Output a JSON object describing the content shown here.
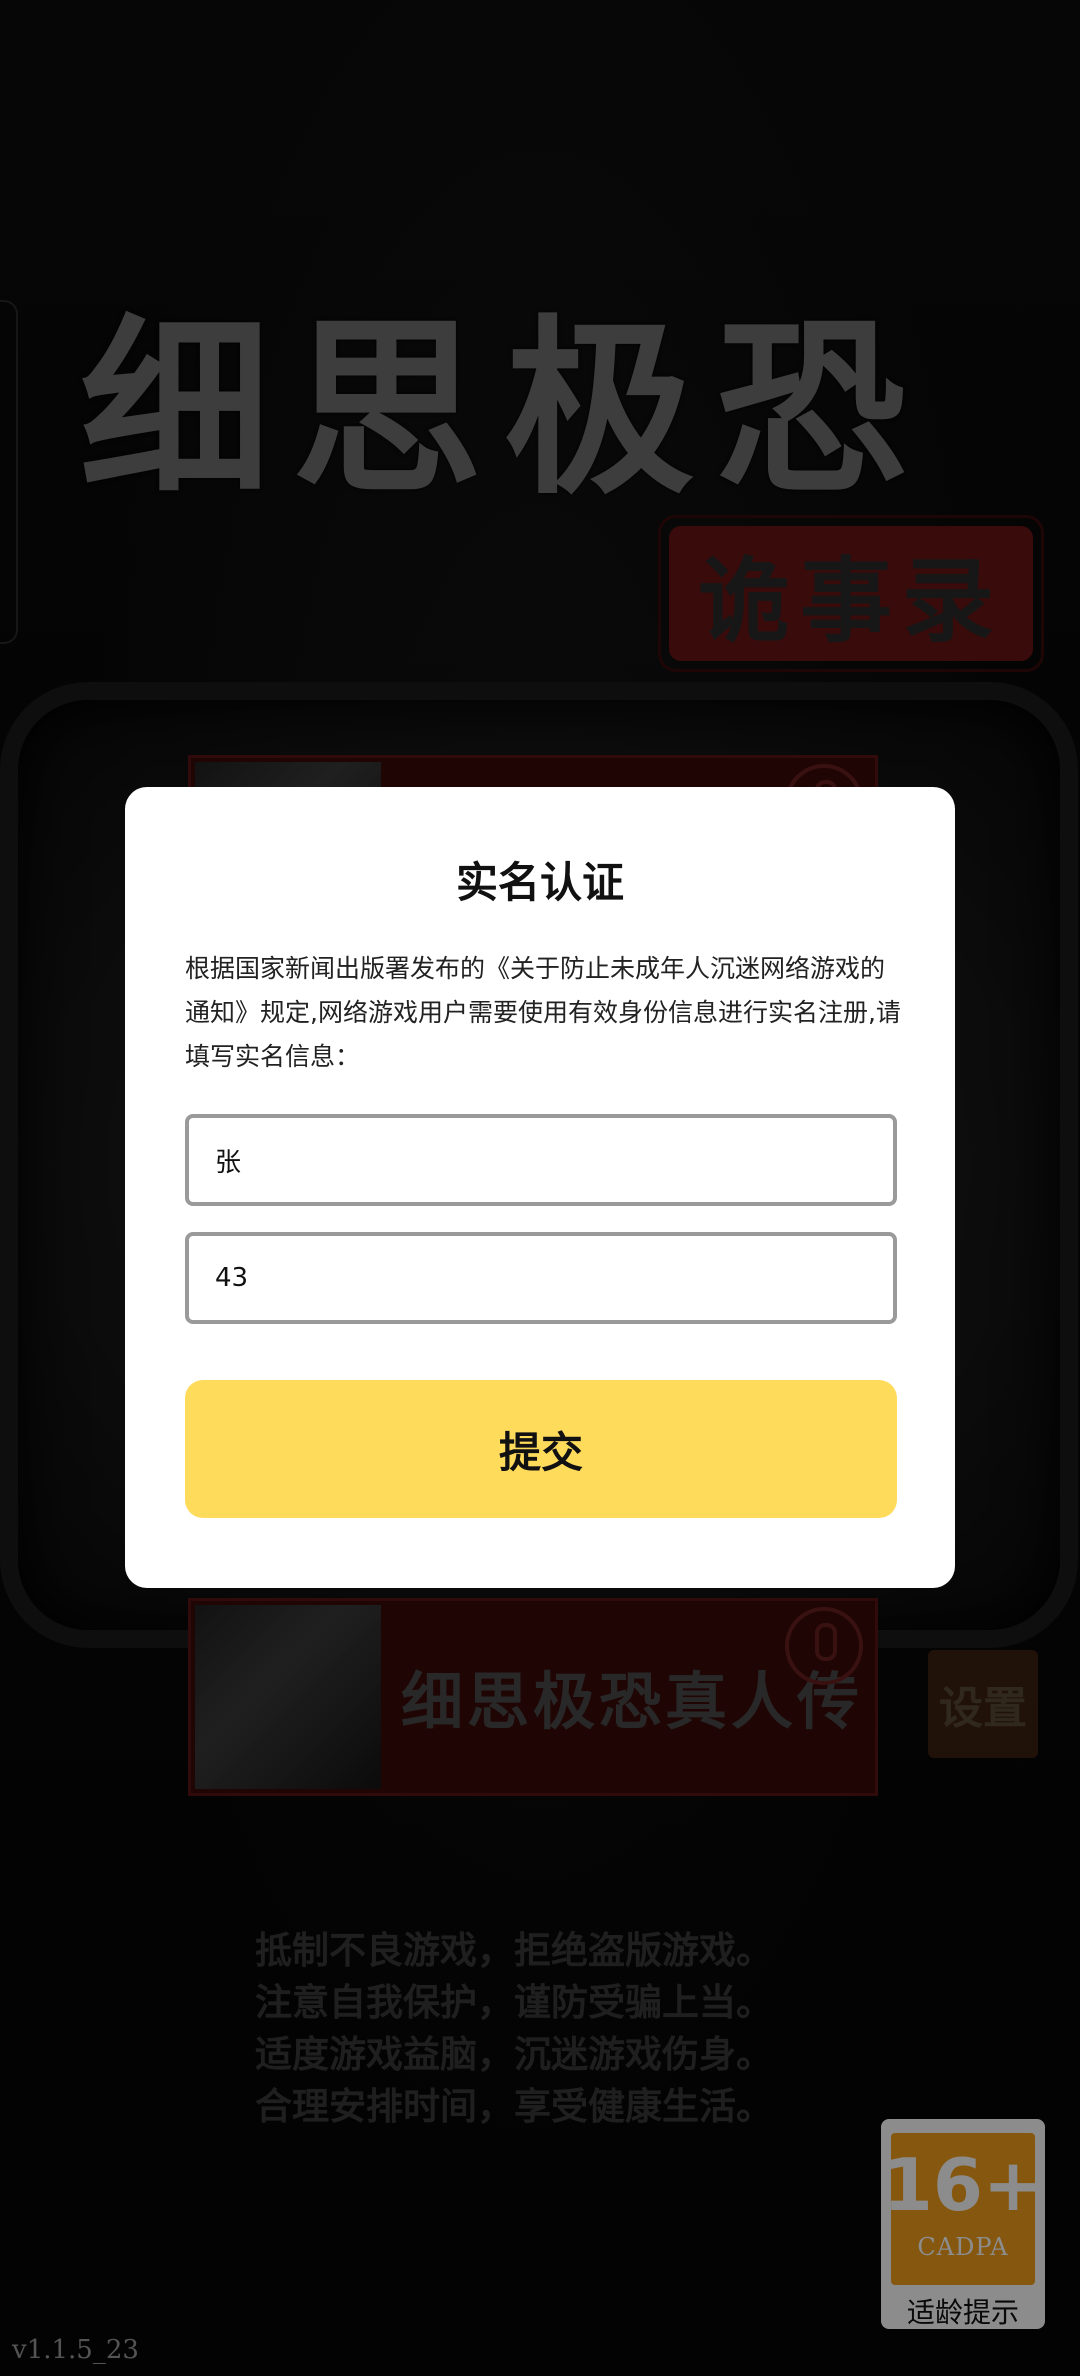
{
  "background": {
    "game_title": "细思极恐",
    "game_subtitle": "诡事录",
    "story_cards": [
      {
        "title": ""
      },
      {
        "title": "细思极恐真人传"
      }
    ],
    "settings_label": "设置",
    "health_notice": [
      "抵制不良游戏，拒绝盗版游戏。",
      "注意自我保护，谨防受骗上当。",
      "适度游戏益脑，沉迷游戏伤身。",
      "合理安排时间，享受健康生活。"
    ],
    "version": "v1.1.5_23",
    "age_rating": {
      "number": "16+",
      "org": "CADPA",
      "hint": "适龄提示",
      "color": "#f4a11d"
    }
  },
  "modal": {
    "title": "实名认证",
    "description": "根据国家新闻出版署发布的《关于防止未成年人沉迷网络游戏的通知》规定,网络游戏用户需要使用有效身份信息进行实名注册,请填写实名信息：",
    "name_value": "张",
    "id_value": "43",
    "submit_label": "提交",
    "submit_color": "#ffdb5c"
  }
}
